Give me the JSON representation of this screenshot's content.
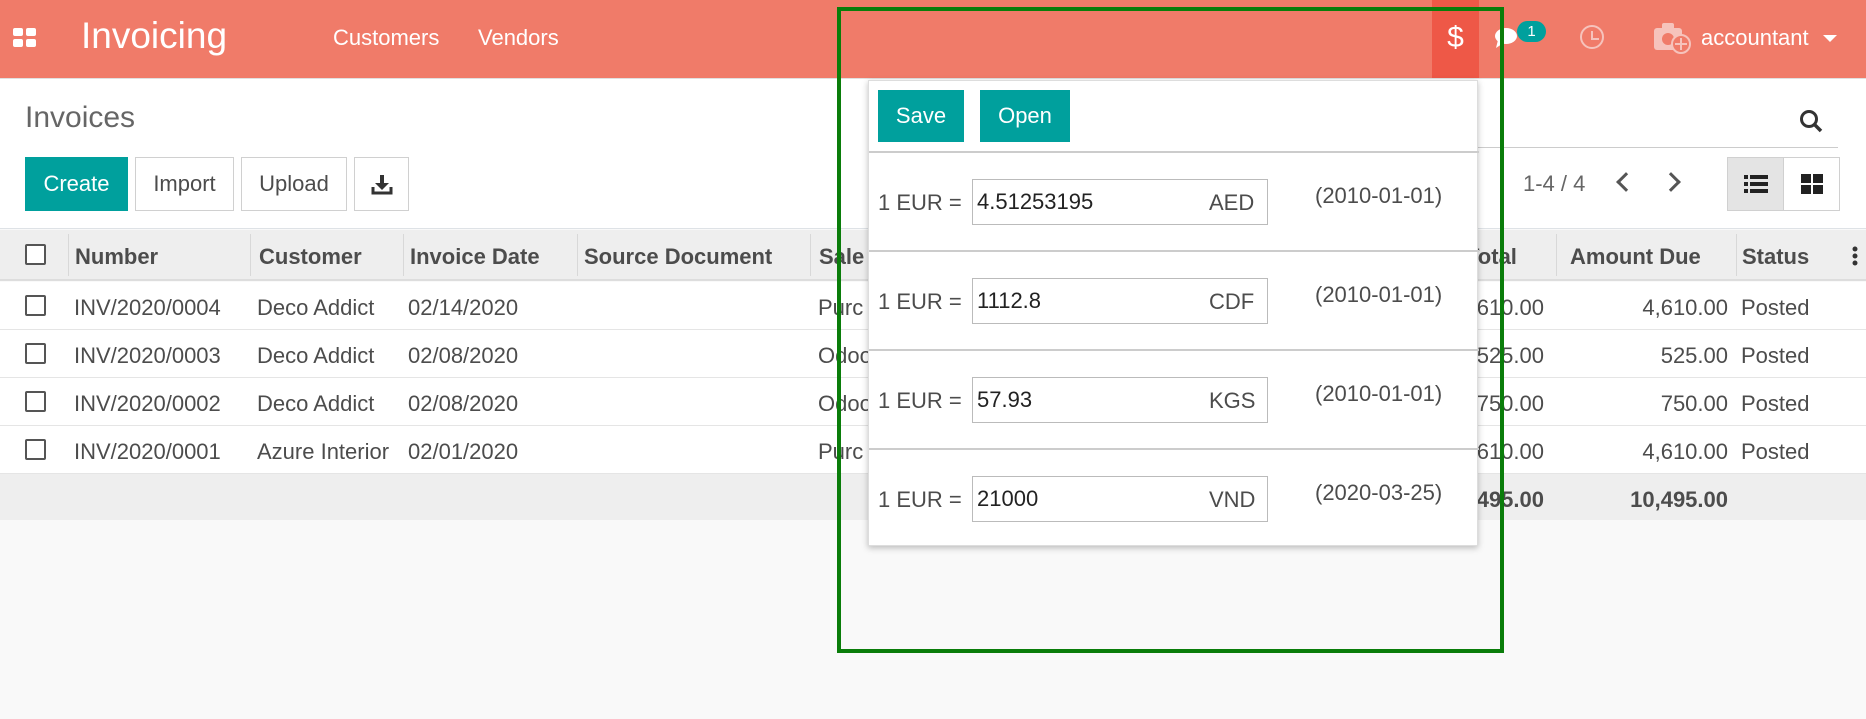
{
  "topbar": {
    "brand": "Invoicing",
    "menu": [
      "Customers",
      "Vendors"
    ],
    "currency_symbol": "$",
    "messages_badge": "1",
    "user": "accountant"
  },
  "control": {
    "title": "Invoices",
    "create": "Create",
    "import": "Import",
    "upload": "Upload",
    "pager": "1-4 / 4"
  },
  "columns": [
    "Number",
    "Customer",
    "Invoice Date",
    "Source Document",
    "Sale",
    "Total",
    "Amount Due",
    "Status"
  ],
  "rows": [
    {
      "number": "INV/2020/0004",
      "customer": "Deco Addict",
      "date": "02/14/2020",
      "source": "Purc",
      "total": "610.00",
      "due": "4,610.00",
      "status": "Posted"
    },
    {
      "number": "INV/2020/0003",
      "customer": "Deco Addict",
      "date": "02/08/2020",
      "source": "Odoo",
      "total": "525.00",
      "due": "525.00",
      "status": "Posted"
    },
    {
      "number": "INV/2020/0002",
      "customer": "Deco Addict",
      "date": "02/08/2020",
      "source": "Odoo",
      "total": "750.00",
      "due": "750.00",
      "status": "Posted"
    },
    {
      "number": "INV/2020/0001",
      "customer": "Azure Interior",
      "date": "02/01/2020",
      "source": "Purc",
      "total": "610.00",
      "due": "4,610.00",
      "status": "Posted"
    }
  ],
  "totals": {
    "total": "495.00",
    "due": "10,495.00"
  },
  "popover": {
    "save": "Save",
    "open": "Open",
    "rates": [
      {
        "label": "1 EUR =",
        "value": "4.51253195",
        "code": "AED",
        "date": "(2010-01-01)"
      },
      {
        "label": "1 EUR =",
        "value": "1112.8",
        "code": "CDF",
        "date": "(2010-01-01)"
      },
      {
        "label": "1 EUR =",
        "value": "57.93",
        "code": "KGS",
        "date": "(2010-01-01)"
      },
      {
        "label": "1 EUR =",
        "value": "21000",
        "code": "VND",
        "date": "(2020-03-25)"
      }
    ]
  },
  "colors": {
    "topbar": "#f07b69",
    "primary": "#00a09d",
    "highlight": "#0a7d0a"
  }
}
